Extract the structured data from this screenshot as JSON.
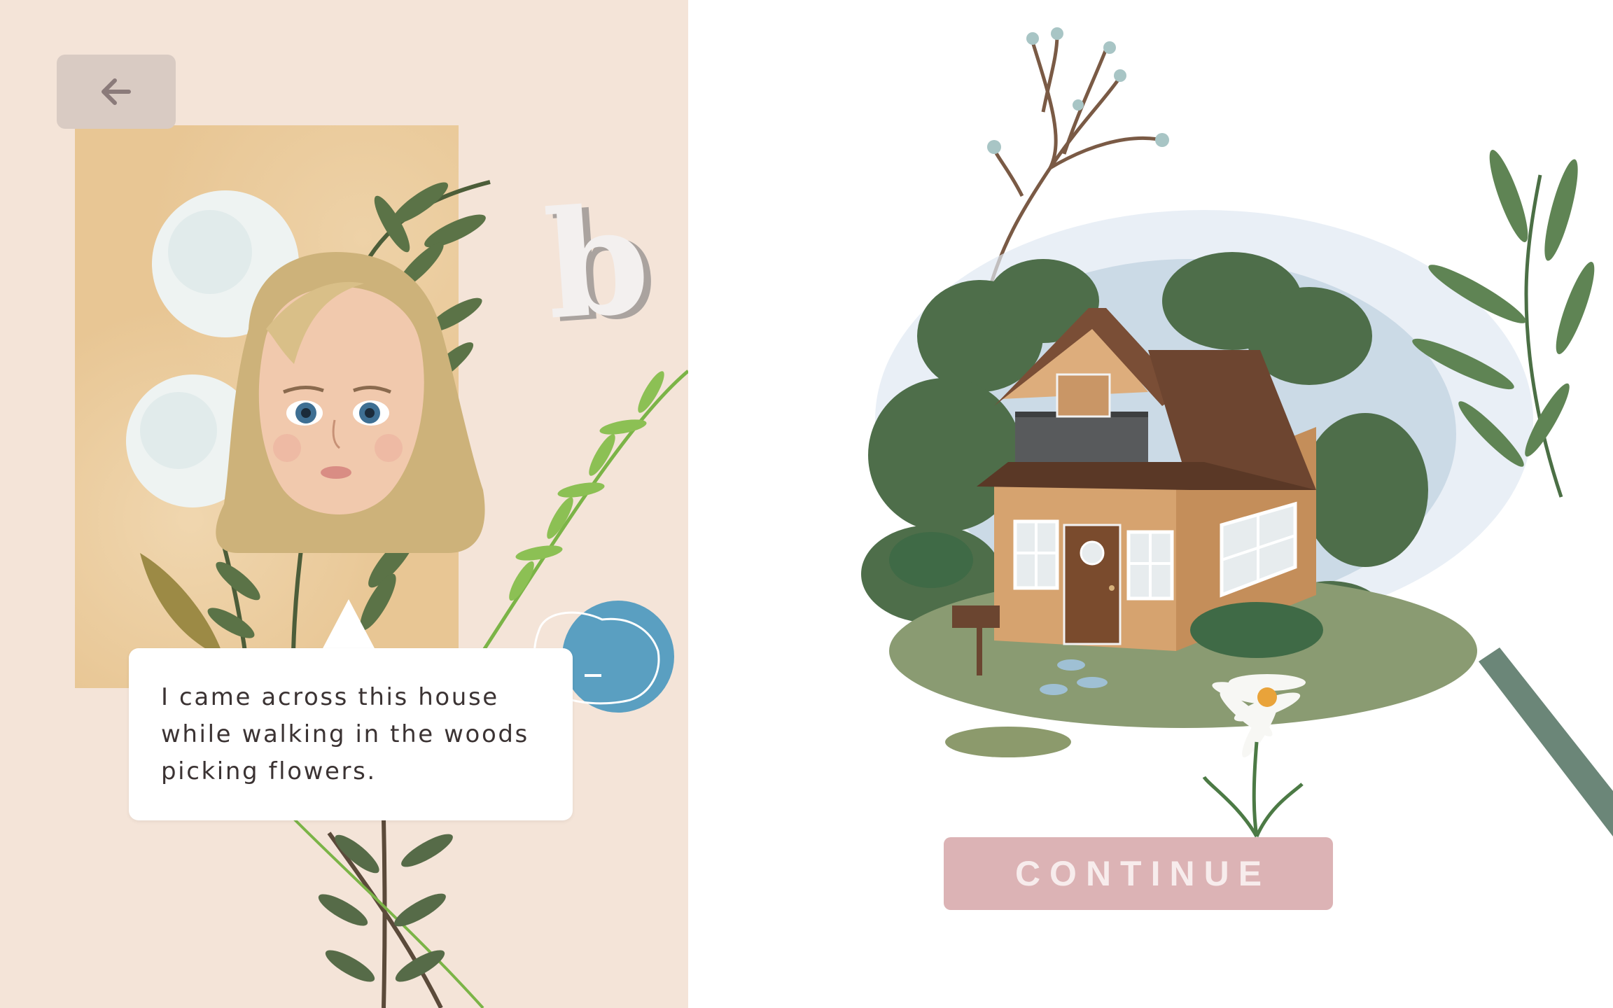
{
  "scene": {
    "dialogue": "I came across this house\nwhile walking in the woods\npicking flowers.",
    "continue_label": "CONTINUE",
    "decorative_letter": "b"
  },
  "icons": {
    "back": "arrow-left-icon"
  },
  "colors": {
    "left_background": "#f4e4d8",
    "right_background": "#ffffff",
    "back_button": "#d9cbc3",
    "continue_button": "#dcb3b5",
    "continue_text": "#f7ecec",
    "dialogue_text": "#3b3333"
  }
}
